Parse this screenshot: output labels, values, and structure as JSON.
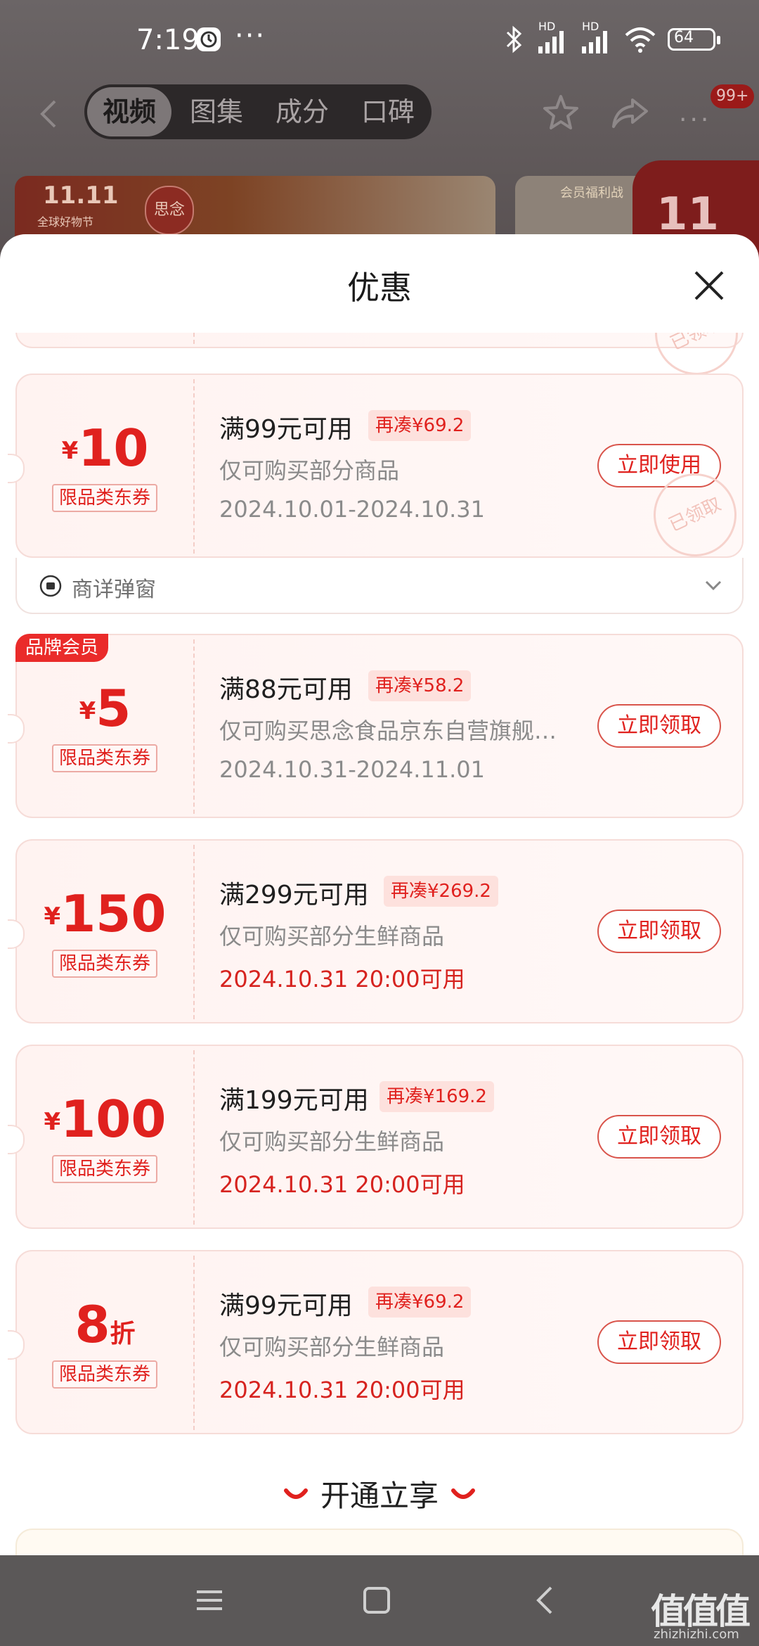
{
  "status_bar": {
    "time": "7:19",
    "more": "···",
    "battery": "64",
    "hd1": "HD",
    "hd2": "HD"
  },
  "app_nav": {
    "tabs": [
      "视频",
      "图集",
      "成分",
      "口碑"
    ],
    "active_tab": 0,
    "badge": "99+"
  },
  "banner": {
    "event_logo": "11.11",
    "event_sub": "全球好物节",
    "brand": "思念",
    "right_label": "会员福利战",
    "promo_logo": "11"
  },
  "sheet": {
    "title": "优惠",
    "open_label": "开通立享",
    "stamp_text": "已领取"
  },
  "coupons": [
    {
      "currency": "¥",
      "amount": "10",
      "suffix": "",
      "type": "限品类东券",
      "condition": "满99元可用",
      "gap": "再凑¥69.2",
      "scope": "仅可购买部分商品",
      "date": "2024.10.01-2024.10.31",
      "date_red": false,
      "button": "立即使用",
      "stamped": true,
      "tag": ""
    },
    {
      "currency": "¥",
      "amount": "5",
      "suffix": "",
      "type": "限品类东券",
      "condition": "满88元可用",
      "gap": "再凑¥58.2",
      "scope": "仅可购买思念食品京东自营旗舰…",
      "date": "2024.10.31-2024.11.01",
      "date_red": false,
      "button": "立即领取",
      "stamped": false,
      "tag": "品牌会员"
    },
    {
      "currency": "¥",
      "amount": "150",
      "suffix": "",
      "type": "限品类东券",
      "condition": "满299元可用",
      "gap": "再凑¥269.2",
      "scope": "仅可购买部分生鲜商品",
      "date": "2024.10.31 20:00可用",
      "date_red": true,
      "button": "立即领取",
      "stamped": false,
      "tag": ""
    },
    {
      "currency": "¥",
      "amount": "100",
      "suffix": "",
      "type": "限品类东券",
      "condition": "满199元可用",
      "gap": "再凑¥169.2",
      "scope": "仅可购买部分生鲜商品",
      "date": "2024.10.31 20:00可用",
      "date_red": true,
      "button": "立即领取",
      "stamped": false,
      "tag": ""
    },
    {
      "currency": "",
      "amount": "8",
      "suffix": "折",
      "type": "限品类东券",
      "condition": "满99元可用",
      "gap": "再凑¥69.2",
      "scope": "仅可购买部分生鲜商品",
      "date": "2024.10.31 20:00可用",
      "date_red": true,
      "button": "立即领取",
      "stamped": false,
      "tag": ""
    }
  ],
  "expand_row": {
    "label": "商详弹窗"
  },
  "watermark": {
    "logo": "值值值",
    "sub": "zhizhizhi.com"
  },
  "colors": {
    "accent": "#e0211e",
    "coupon_bg": "#fff3f1",
    "badge_bg": "#fde1dd"
  }
}
